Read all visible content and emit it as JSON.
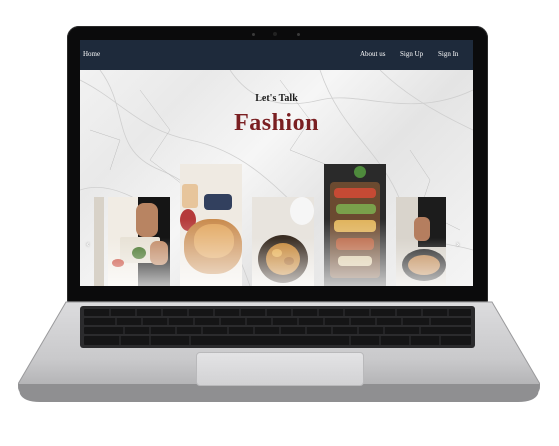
{
  "nav": {
    "home": "Home",
    "about": "About us",
    "signup": "Sign Up",
    "signin": "Sign In"
  },
  "hero": {
    "kicker": "Let's Talk",
    "title": "Fashion"
  },
  "gallery": {
    "prev_icon": "chevron-left-icon",
    "next_icon": "chevron-right-icon",
    "prev_glyph": "‹",
    "next_glyph": "›"
  },
  "colors": {
    "nav_bg": "#1e2a3b",
    "title": "#7a1f22",
    "kicker": "#1a1a1a"
  }
}
